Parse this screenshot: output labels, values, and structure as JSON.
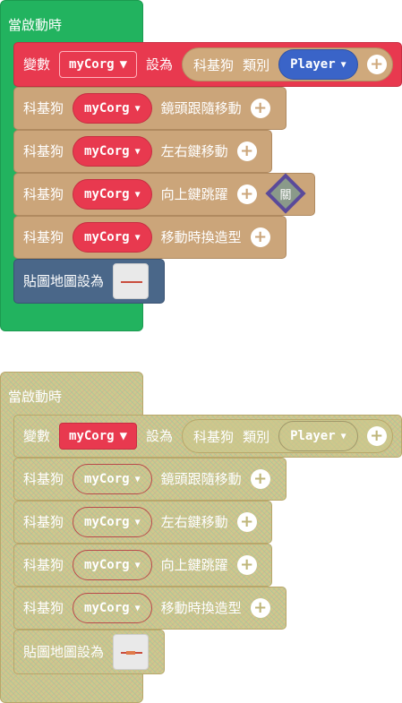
{
  "top": {
    "hat_label": "當啟動時",
    "set_var": {
      "label_var": "變數",
      "var_name": "myCorg",
      "label_set": "設為",
      "sprite_label": "科基狗",
      "kind_label": "類別",
      "kind_value": "Player"
    },
    "rows": [
      {
        "prefix": "科基狗",
        "var": "myCorg",
        "action": "鏡頭跟隨移動"
      },
      {
        "prefix": "科基狗",
        "var": "myCorg",
        "action": "左右鍵移動"
      },
      {
        "prefix": "科基狗",
        "var": "myCorg",
        "action": "向上鍵跳躍",
        "toggle": "關"
      },
      {
        "prefix": "科基狗",
        "var": "myCorg",
        "action": "移動時換造型"
      }
    ],
    "map_label": "貼圖地圖設為"
  },
  "bottom": {
    "hat_label": "當啟動時",
    "set_var": {
      "label_var": "變數",
      "var_name": "myCorg",
      "label_set": "設為",
      "sprite_label": "科基狗",
      "kind_label": "類別",
      "kind_value": "Player"
    },
    "rows": [
      {
        "prefix": "科基狗",
        "var": "myCorg",
        "action": "鏡頭跟隨移動"
      },
      {
        "prefix": "科基狗",
        "var": "myCorg",
        "action": "左右鍵移動"
      },
      {
        "prefix": "科基狗",
        "var": "myCorg",
        "action": "向上鍵跳躍"
      },
      {
        "prefix": "科基狗",
        "var": "myCorg",
        "action": "移動時換造型"
      }
    ],
    "map_label": "貼圖地圖設為"
  },
  "colors": {
    "hat_green": "#22b35f",
    "variable_red": "#e8394f",
    "sprite_tan": "#cba57a",
    "kind_blue": "#3a64c8",
    "map_slate": "#4a6789",
    "disabled_olive": "#cfc88c"
  },
  "icons": {
    "plus": "plus-circle-icon",
    "caret": "caret-down-icon",
    "thumbnail": "tilemap-thumbnail-icon"
  }
}
